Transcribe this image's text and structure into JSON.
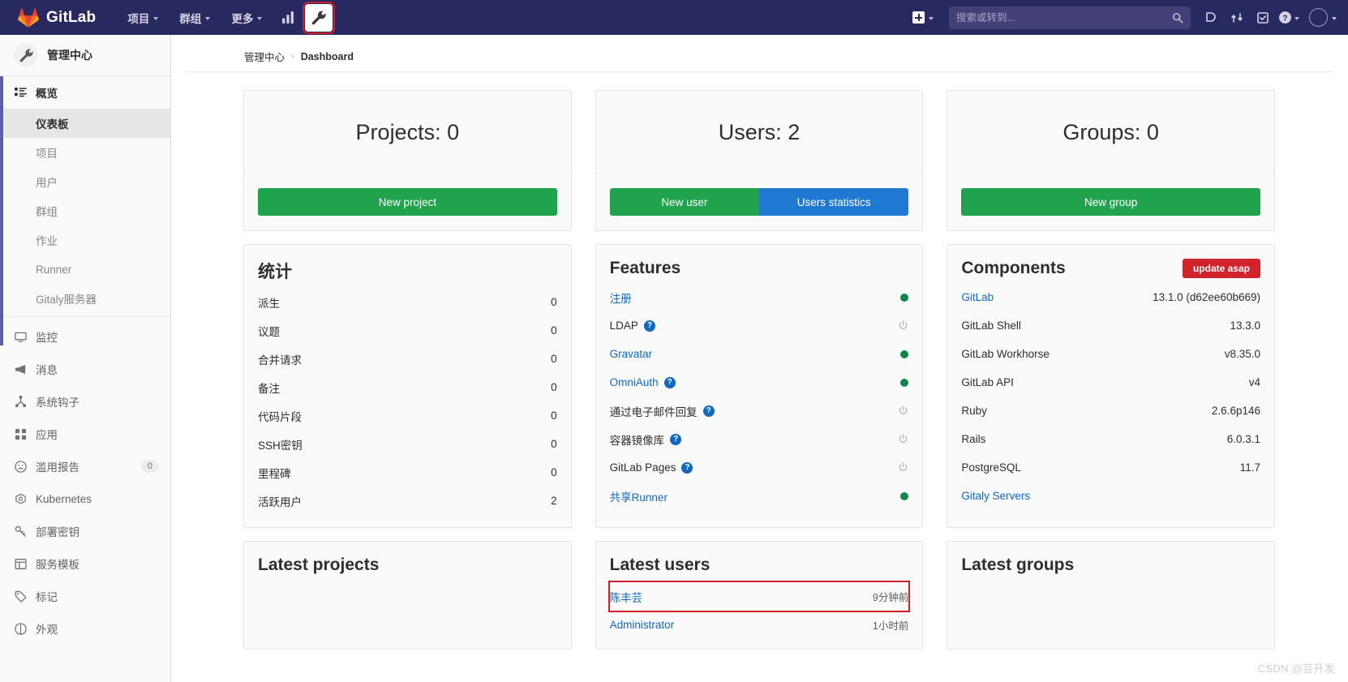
{
  "topnav": {
    "brand": "GitLab",
    "menu": [
      {
        "label": "项目",
        "has_caret": true
      },
      {
        "label": "群组",
        "has_caret": true
      },
      {
        "label": "更多",
        "has_caret": true
      }
    ],
    "icon_buttons": [
      {
        "name": "analytics-icon",
        "active": false,
        "highlighted": false
      },
      {
        "name": "wrench-icon",
        "active": true,
        "highlighted": true
      }
    ],
    "search": {
      "placeholder": "搜索或转到...",
      "value": ""
    },
    "right_icons": [
      {
        "name": "issues-icon"
      },
      {
        "name": "merge-requests-icon"
      },
      {
        "name": "todos-icon"
      },
      {
        "name": "help-icon"
      }
    ]
  },
  "sidebar": {
    "title": "管理中心",
    "group": {
      "label": "概览"
    },
    "sub_items": [
      {
        "label": "仪表板",
        "active": true
      },
      {
        "label": "项目",
        "active": false
      },
      {
        "label": "用户",
        "active": false
      },
      {
        "label": "群组",
        "active": false
      },
      {
        "label": "作业",
        "active": false
      },
      {
        "label": "Runner",
        "active": false
      },
      {
        "label": "Gitaly服务器",
        "active": false
      }
    ],
    "items": [
      {
        "label": "监控",
        "icon": "monitor-icon",
        "badge": null
      },
      {
        "label": "消息",
        "icon": "megaphone-icon",
        "badge": null
      },
      {
        "label": "系统钩子",
        "icon": "hook-icon",
        "badge": null
      },
      {
        "label": "应用",
        "icon": "applications-icon",
        "badge": null
      },
      {
        "label": "滥用报告",
        "icon": "frown-icon",
        "badge": "0"
      },
      {
        "label": "Kubernetes",
        "icon": "kubernetes-icon",
        "badge": null
      },
      {
        "label": "部署密钥",
        "icon": "key-icon",
        "badge": null
      },
      {
        "label": "服务模板",
        "icon": "template-icon",
        "badge": null
      },
      {
        "label": "标记",
        "icon": "tag-icon",
        "badge": null
      },
      {
        "label": "外观",
        "icon": "appearance-icon",
        "badge": null
      }
    ]
  },
  "breadcrumb": {
    "root": "管理中心",
    "separator": "›",
    "current": "Dashboard"
  },
  "counters": [
    {
      "title": "Projects: 0",
      "buttons": [
        {
          "label": "New project",
          "style": "green"
        }
      ]
    },
    {
      "title": "Users: 2",
      "buttons": [
        {
          "label": "New user",
          "style": "green"
        },
        {
          "label": "Users statistics",
          "style": "blue"
        }
      ]
    },
    {
      "title": "Groups: 0",
      "buttons": [
        {
          "label": "New group",
          "style": "green"
        }
      ]
    }
  ],
  "statistics": {
    "title": "统计",
    "rows": [
      {
        "label": "派生",
        "value": "0"
      },
      {
        "label": "议题",
        "value": "0"
      },
      {
        "label": "合并请求",
        "value": "0"
      },
      {
        "label": "备注",
        "value": "0"
      },
      {
        "label": "代码片段",
        "value": "0"
      },
      {
        "label": "SSH密钥",
        "value": "0"
      },
      {
        "label": "里程碑",
        "value": "0"
      },
      {
        "label": "活跃用户",
        "value": "2"
      }
    ]
  },
  "features": {
    "title": "Features",
    "rows": [
      {
        "label": "注册",
        "is_link": true,
        "help": false,
        "status": "on"
      },
      {
        "label": "LDAP",
        "is_link": false,
        "help": true,
        "status": "off"
      },
      {
        "label": "Gravatar",
        "is_link": true,
        "help": false,
        "status": "on"
      },
      {
        "label": "OmniAuth",
        "is_link": true,
        "help": true,
        "status": "on"
      },
      {
        "label": "通过电子邮件回复",
        "is_link": false,
        "help": true,
        "status": "off"
      },
      {
        "label": "容器镜像库",
        "is_link": false,
        "help": true,
        "status": "off"
      },
      {
        "label": "GitLab Pages",
        "is_link": false,
        "help": true,
        "status": "off"
      },
      {
        "label": "共享Runner",
        "is_link": true,
        "help": false,
        "status": "on"
      }
    ]
  },
  "components": {
    "title": "Components",
    "update_badge": "update asap",
    "rows": [
      {
        "label": "GitLab",
        "is_link": true,
        "value": "13.1.0 (d62ee60b669)"
      },
      {
        "label": "GitLab Shell",
        "is_link": false,
        "value": "13.3.0"
      },
      {
        "label": "GitLab Workhorse",
        "is_link": false,
        "value": "v8.35.0"
      },
      {
        "label": "GitLab API",
        "is_link": false,
        "value": "v4"
      },
      {
        "label": "Ruby",
        "is_link": false,
        "value": "2.6.6p146"
      },
      {
        "label": "Rails",
        "is_link": false,
        "value": "6.0.3.1"
      },
      {
        "label": "PostgreSQL",
        "is_link": false,
        "value": "11.7"
      },
      {
        "label": "Gitaly Servers",
        "is_link": true,
        "value": ""
      }
    ]
  },
  "latest_projects": {
    "title": "Latest projects",
    "rows": []
  },
  "latest_users": {
    "title": "Latest users",
    "rows": [
      {
        "name": "陈丰芸",
        "time": "9分钟前",
        "flagged": true
      },
      {
        "name": "Administrator",
        "time": "1小时前",
        "flagged": false
      }
    ]
  },
  "latest_groups": {
    "title": "Latest groups",
    "rows": []
  },
  "watermark": "CSDN @芸开发",
  "colors": {
    "nav_bg": "#292961",
    "green": "#21a24d",
    "blue": "#1f78d1",
    "link": "#1068bf",
    "danger": "#d1232c",
    "status_on": "#108548",
    "highlight": "#cc2029"
  }
}
